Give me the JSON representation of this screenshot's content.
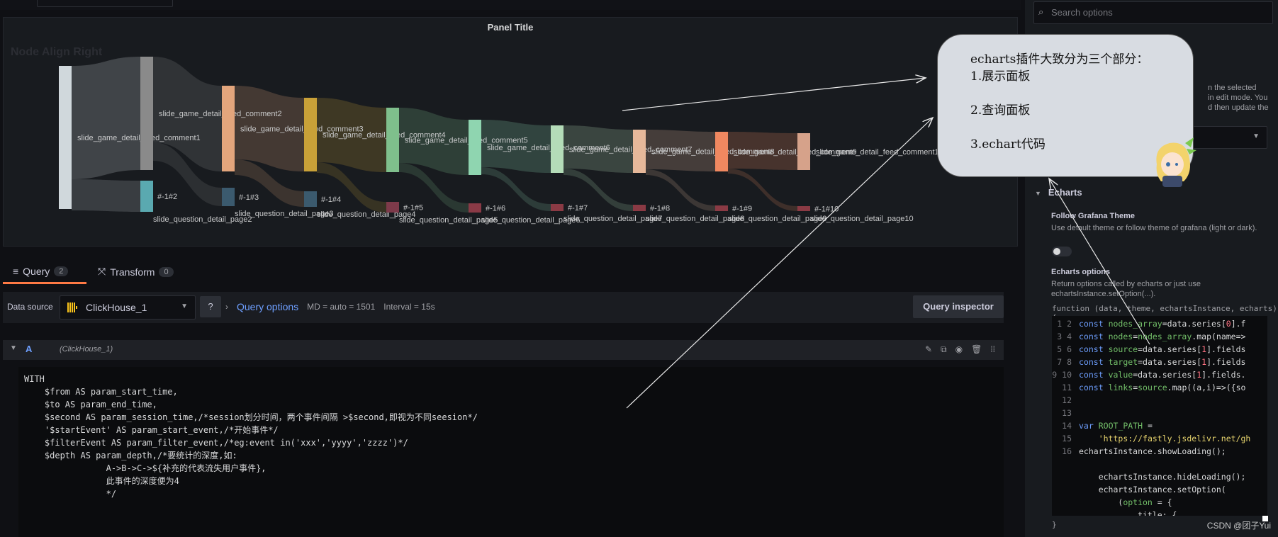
{
  "panel": {
    "title": "Panel Title",
    "chart_title": "Node Align Right"
  },
  "sankey": {
    "nodes": [
      "slide_game_detail_feed_comment1",
      "slide_game_detail_feed_comment2",
      "slide_game_detail_feed_comment3",
      "slide_game_detail_feed_comment4",
      "slide_game_detail_feed_comment5",
      "slide_game_detail_feed_comment6",
      "slide_game_detail_feed_comment7",
      "slide_game_detail_feed_comment8",
      "slide_game_detail_feed_comment9",
      "slide_game_detail_feed_comment10",
      "#-1#2",
      "#-1#3",
      "#-1#4",
      "#-1#5",
      "#-1#6",
      "#-1#7",
      "#-1#8",
      "#-1#9",
      "#-1#10",
      "slide_question_detail_page2",
      "slide_question_detail_page3",
      "slide_question_detail_page4",
      "slide_question_detail_page5",
      "slide_question_detail_page6",
      "slide_question_detail_page7",
      "slide_question_detail_page8",
      "slide_question_detail_page9",
      "slide_question_detail_page10"
    ],
    "colors": [
      "#d0d8dc",
      "#8a8a8a",
      "#e3a57c",
      "#c9a138",
      "#7fbf8c",
      "#8fd5b0",
      "#b4dcb8",
      "#e6b89a",
      "#f08860",
      "#d6a28a"
    ]
  },
  "tabs": [
    {
      "label": "Query",
      "count": "2"
    },
    {
      "label": "Transform",
      "count": "0"
    }
  ],
  "query_bar": {
    "datasource_label": "Data source",
    "datasource_name": "ClickHouse_1",
    "query_options": "Query options",
    "md": "MD = auto = 1501",
    "interval": "Interval = 15s",
    "inspector": "Query inspector"
  },
  "query_row": {
    "letter": "A",
    "datasource": "(ClickHouse_1)"
  },
  "sql_lines": [
    "WITH",
    "    $from AS param_start_time,",
    "    $to AS param_end_time,",
    "    $second AS param_session_time,/*session划分时间，两个事件间隔 >$second,即视为不同seesion*/",
    "    '$startEvent' AS param_start_event,/*开始事件*/",
    "    $filterEvent AS param_filter_event,/*eg:event in('xxx','yyyy','zzzz')*/",
    "    $depth AS param_depth,/*要统计的深度,如:",
    "                A->B->C->${补充的代表流失用户事件},",
    "                此事件的深度便为4",
    "                */"
  ],
  "sidebar": {
    "search_placeholder": "Search options",
    "desc_frag": [
      "n the selected",
      "in edit mode. You",
      "d then update the"
    ],
    "section": "Echarts",
    "follow_label": "Follow Grafana Theme",
    "follow_desc": "Use default theme or follow theme of grafana (light or dark).",
    "options_label": "Echarts options",
    "options_desc": "Return options called by echarts or just use echartsInstance.setOption(...).",
    "fn_sig": "function (data, theme, echartsInstance, echarts) {",
    "closing": "}"
  },
  "code_lines": [
    "const nodes_array=data.series[0].f",
    "const nodes=nodes_array.map(name=>",
    "const source=data.series[1].fields",
    "const target=data.series[1].fields",
    "const value=data.series[1].fields.",
    "const links=source.map((a,i)=>({so",
    "",
    "",
    "var ROOT_PATH =",
    "    'https://fastly.jsdelivr.net/gh",
    "echartsInstance.showLoading();",
    "",
    "    echartsInstance.hideLoading();",
    "    echartsInstance.setOption(",
    "        (option = {",
    "            title: {"
  ],
  "annotation": {
    "line1": "echarts插件大致分为三个部分：",
    "line2": "1.展示面板",
    "line3": "2.查询面板",
    "line4": "3.echart代码"
  },
  "watermark": "CSDN @团子Yui"
}
